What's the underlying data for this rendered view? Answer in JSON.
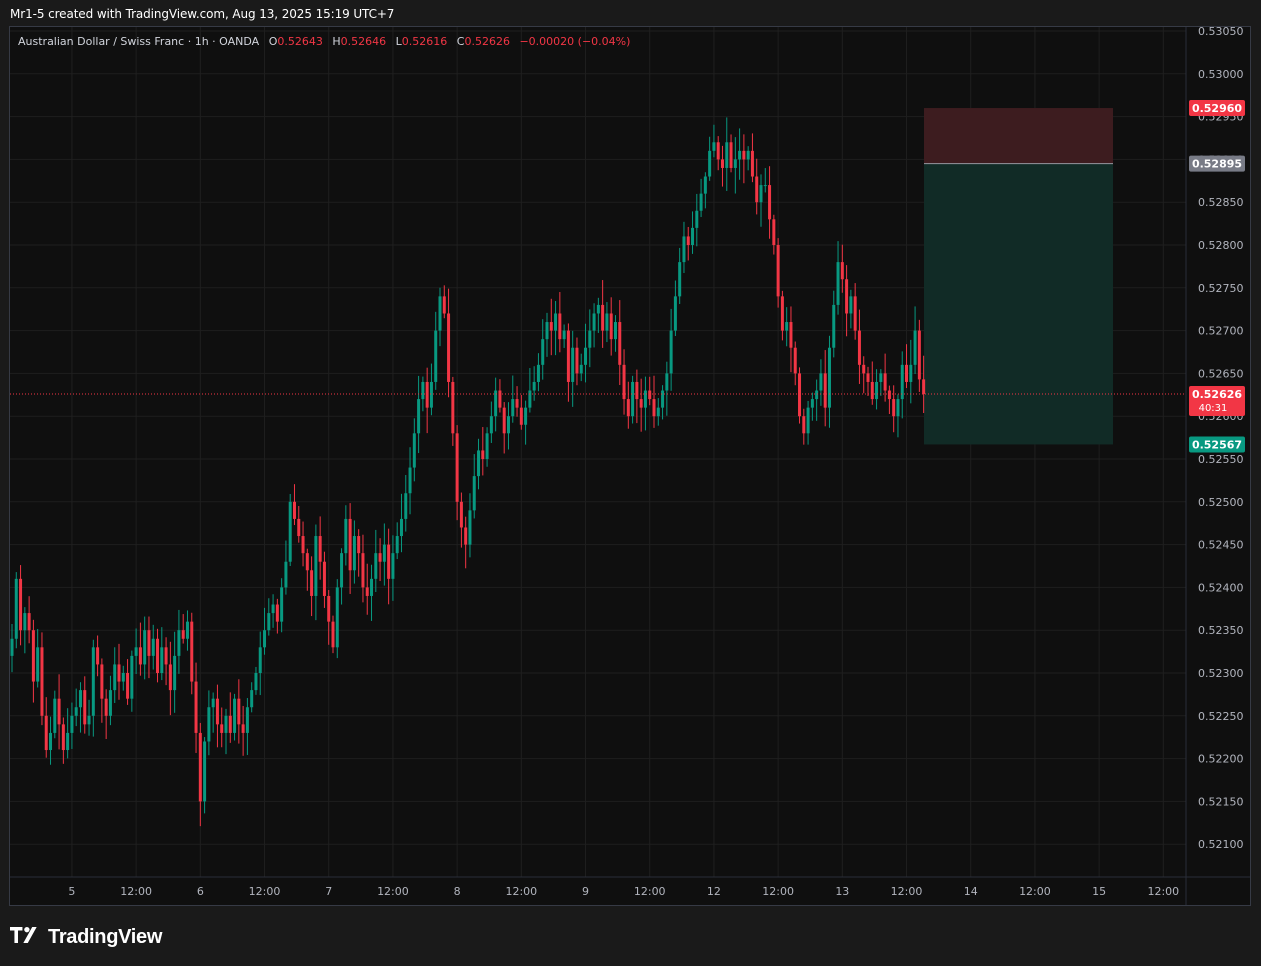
{
  "header": {
    "credit": "Mr1-5 created with TradingView.com, Aug 13, 2025 15:19 UTC+7"
  },
  "legend": {
    "symbol": "Australian Dollar / Swiss Franc · 1h · OANDA",
    "open_label": "O",
    "open": "0.52643",
    "high_label": "H",
    "high": "0.52646",
    "low_label": "L",
    "low": "0.52616",
    "close_label": "C",
    "close": "0.52626",
    "change": "−0.00020 (−0.04%)"
  },
  "footer": {
    "brand": "TradingView",
    "logo_icon": "tradingview-logo-icon"
  },
  "colors": {
    "up": "#089981",
    "down": "#f23645",
    "background": "#0f0f0f",
    "grid": "#1f1f1f",
    "stop_zone": "#3d1c1f",
    "target_zone": "#112b26"
  },
  "chart_data": {
    "type": "candlestick",
    "symbol": "AUDCHF",
    "timeframe": "1h",
    "ylim": [
      0.5206,
      0.5306
    ],
    "y_ticks": [
      0.5305,
      0.53,
      0.5295,
      0.529,
      0.5285,
      0.528,
      0.5275,
      0.527,
      0.5265,
      0.526,
      0.5255,
      0.525,
      0.5245,
      0.524,
      0.5235,
      0.523,
      0.5225,
      0.522,
      0.5215,
      0.521
    ],
    "y_tick_labels": [
      "0.53050",
      "0.53000",
      "0.52950",
      "0.52900",
      "0.52850",
      "0.52800",
      "0.52750",
      "0.52700",
      "0.52650",
      "0.52600",
      "0.52550",
      "0.52500",
      "0.52450",
      "0.52400",
      "0.52350",
      "0.52300",
      "0.52250",
      "0.52200",
      "0.52150",
      "0.52100"
    ],
    "x_ticks": [
      {
        "bar": 14,
        "label": "5"
      },
      {
        "bar": 29,
        "label": "12:00"
      },
      {
        "bar": 44,
        "label": "6"
      },
      {
        "bar": 59,
        "label": "12:00"
      },
      {
        "bar": 74,
        "label": "7"
      },
      {
        "bar": 89,
        "label": "12:00"
      },
      {
        "bar": 104,
        "label": "8"
      },
      {
        "bar": 119,
        "label": "12:00"
      },
      {
        "bar": 134,
        "label": "9"
      },
      {
        "bar": 149,
        "label": "12:00"
      },
      {
        "bar": 164,
        "label": "12"
      },
      {
        "bar": 179,
        "label": "12:00"
      },
      {
        "bar": 194,
        "label": "13"
      },
      {
        "bar": 209,
        "label": "12:00"
      },
      {
        "bar": 224,
        "label": "14"
      },
      {
        "bar": 239,
        "label": "12:00"
      },
      {
        "bar": 254,
        "label": "15"
      },
      {
        "bar": 269,
        "label": "12:00"
      }
    ],
    "bar_count_visible": 272,
    "close_series": [
      0.5234,
      0.5241,
      0.5235,
      0.5237,
      0.5235,
      0.5229,
      0.5233,
      0.5225,
      0.5221,
      0.5223,
      0.5227,
      0.5224,
      0.5221,
      0.5223,
      0.5225,
      0.5226,
      0.5228,
      0.5224,
      0.5225,
      0.5233,
      0.5231,
      0.5227,
      0.5225,
      0.5228,
      0.5231,
      0.5229,
      0.523,
      0.5227,
      0.5232,
      0.5233,
      0.5231,
      0.5235,
      0.5232,
      0.5234,
      0.523,
      0.5233,
      0.5231,
      0.5228,
      0.5232,
      0.5235,
      0.5234,
      0.5236,
      0.5229,
      0.5223,
      0.5215,
      0.5222,
      0.5226,
      0.5227,
      0.5224,
      0.5223,
      0.5225,
      0.5223,
      0.5227,
      0.5224,
      0.5223,
      0.5226,
      0.5228,
      0.523,
      0.5233,
      0.5235,
      0.5237,
      0.5238,
      0.5236,
      0.524,
      0.5243,
      0.525,
      0.5248,
      0.5246,
      0.5244,
      0.5242,
      0.5239,
      0.5246,
      0.5243,
      0.5239,
      0.5236,
      0.5233,
      0.524,
      0.5244,
      0.5248,
      0.5242,
      0.5246,
      0.5244,
      0.524,
      0.5239,
      0.5241,
      0.5244,
      0.5243,
      0.5245,
      0.5241,
      0.5244,
      0.5246,
      0.5248,
      0.5251,
      0.5254,
      0.5258,
      0.5262,
      0.5264,
      0.5261,
      0.5264,
      0.527,
      0.5274,
      0.5272,
      0.5264,
      0.5258,
      0.525,
      0.5247,
      0.5245,
      0.5249,
      0.5253,
      0.5256,
      0.5255,
      0.5258,
      0.526,
      0.5263,
      0.5261,
      0.5258,
      0.526,
      0.5262,
      0.5261,
      0.5259,
      0.5261,
      0.5263,
      0.5264,
      0.5266,
      0.5269,
      0.5271,
      0.527,
      0.5272,
      0.5269,
      0.527,
      0.5264,
      0.5268,
      0.5265,
      0.5266,
      0.5268,
      0.527,
      0.5272,
      0.5273,
      0.527,
      0.5272,
      0.5269,
      0.5271,
      0.5266,
      0.5262,
      0.526,
      0.5264,
      0.5262,
      0.5261,
      0.5263,
      0.5262,
      0.526,
      0.5261,
      0.5263,
      0.5265,
      0.527,
      0.5274,
      0.5278,
      0.5281,
      0.528,
      0.5282,
      0.5284,
      0.5286,
      0.5288,
      0.5291,
      0.5292,
      0.529,
      0.5289,
      0.5292,
      0.5289,
      0.529,
      0.5291,
      0.529,
      0.5291,
      0.5288,
      0.5285,
      0.5287,
      0.5287,
      0.5283,
      0.528,
      0.5274,
      0.527,
      0.5271,
      0.5268,
      0.5265,
      0.526,
      0.5258,
      0.5261,
      0.5262,
      0.5263,
      0.5265,
      0.5261,
      0.5268,
      0.5273,
      0.5278,
      0.5276,
      0.5272,
      0.5274,
      0.527,
      0.5266,
      0.5265,
      0.5264,
      0.5262,
      0.5264,
      0.5265,
      0.5263,
      0.5262,
      0.526,
      0.5262,
      0.5266,
      0.5264,
      0.5266,
      0.527,
      0.52643,
      0.52626
    ]
  },
  "position": {
    "type": "short",
    "stop_price": 0.5296,
    "entry_price": 0.52895,
    "target_price": 0.52567,
    "stop_label": "0.52960",
    "entry_label": "0.52895",
    "target_label": "0.52567"
  },
  "current_price": {
    "value": 0.52626,
    "label": "0.52626",
    "countdown": "40:31"
  }
}
